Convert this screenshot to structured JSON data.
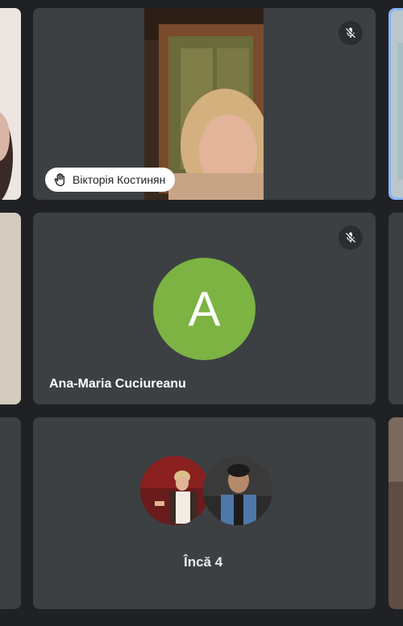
{
  "tiles": [
    {
      "id": "tile-top-center",
      "name": "Вікторія Костинян",
      "hand_raised": true,
      "muted": true
    },
    {
      "id": "tile-mid-center",
      "name": "Ana-Maria Cuciureanu",
      "avatar_letter": "A",
      "avatar_color": "#7cb342",
      "muted": true
    },
    {
      "id": "tile-bottom-center",
      "overflow_label": "Încă 4"
    }
  ],
  "colors": {
    "background": "#202124",
    "tile": "#3c4043",
    "active_border": "#8ab4f8"
  },
  "icons": {
    "mic_off": "mic-off-icon",
    "hand": "raised-hand-icon"
  }
}
